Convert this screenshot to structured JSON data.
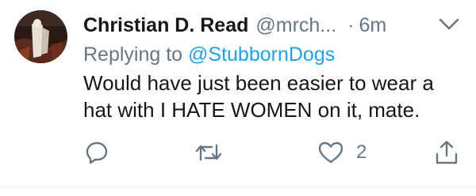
{
  "tweet": {
    "author": {
      "display_name": "Christian D. Read",
      "handle": "@mrch...",
      "avatar_icon": "profile-photo"
    },
    "separator": "·",
    "time": "6m",
    "replying_prefix": "Replying to ",
    "replying_to": "@StubbornDogs",
    "text_lines": [
      "Would have just been easier to wear a",
      "hat with I HATE WOMEN on it, mate."
    ],
    "actions": {
      "reply_icon": "reply-icon",
      "retweet_icon": "retweet-icon",
      "like_icon": "heart-icon",
      "like_count": "2",
      "share_icon": "share-icon"
    },
    "colors": {
      "secondary_text": "#657786",
      "link": "#1da1f2",
      "primary_text": "#14171a"
    }
  }
}
